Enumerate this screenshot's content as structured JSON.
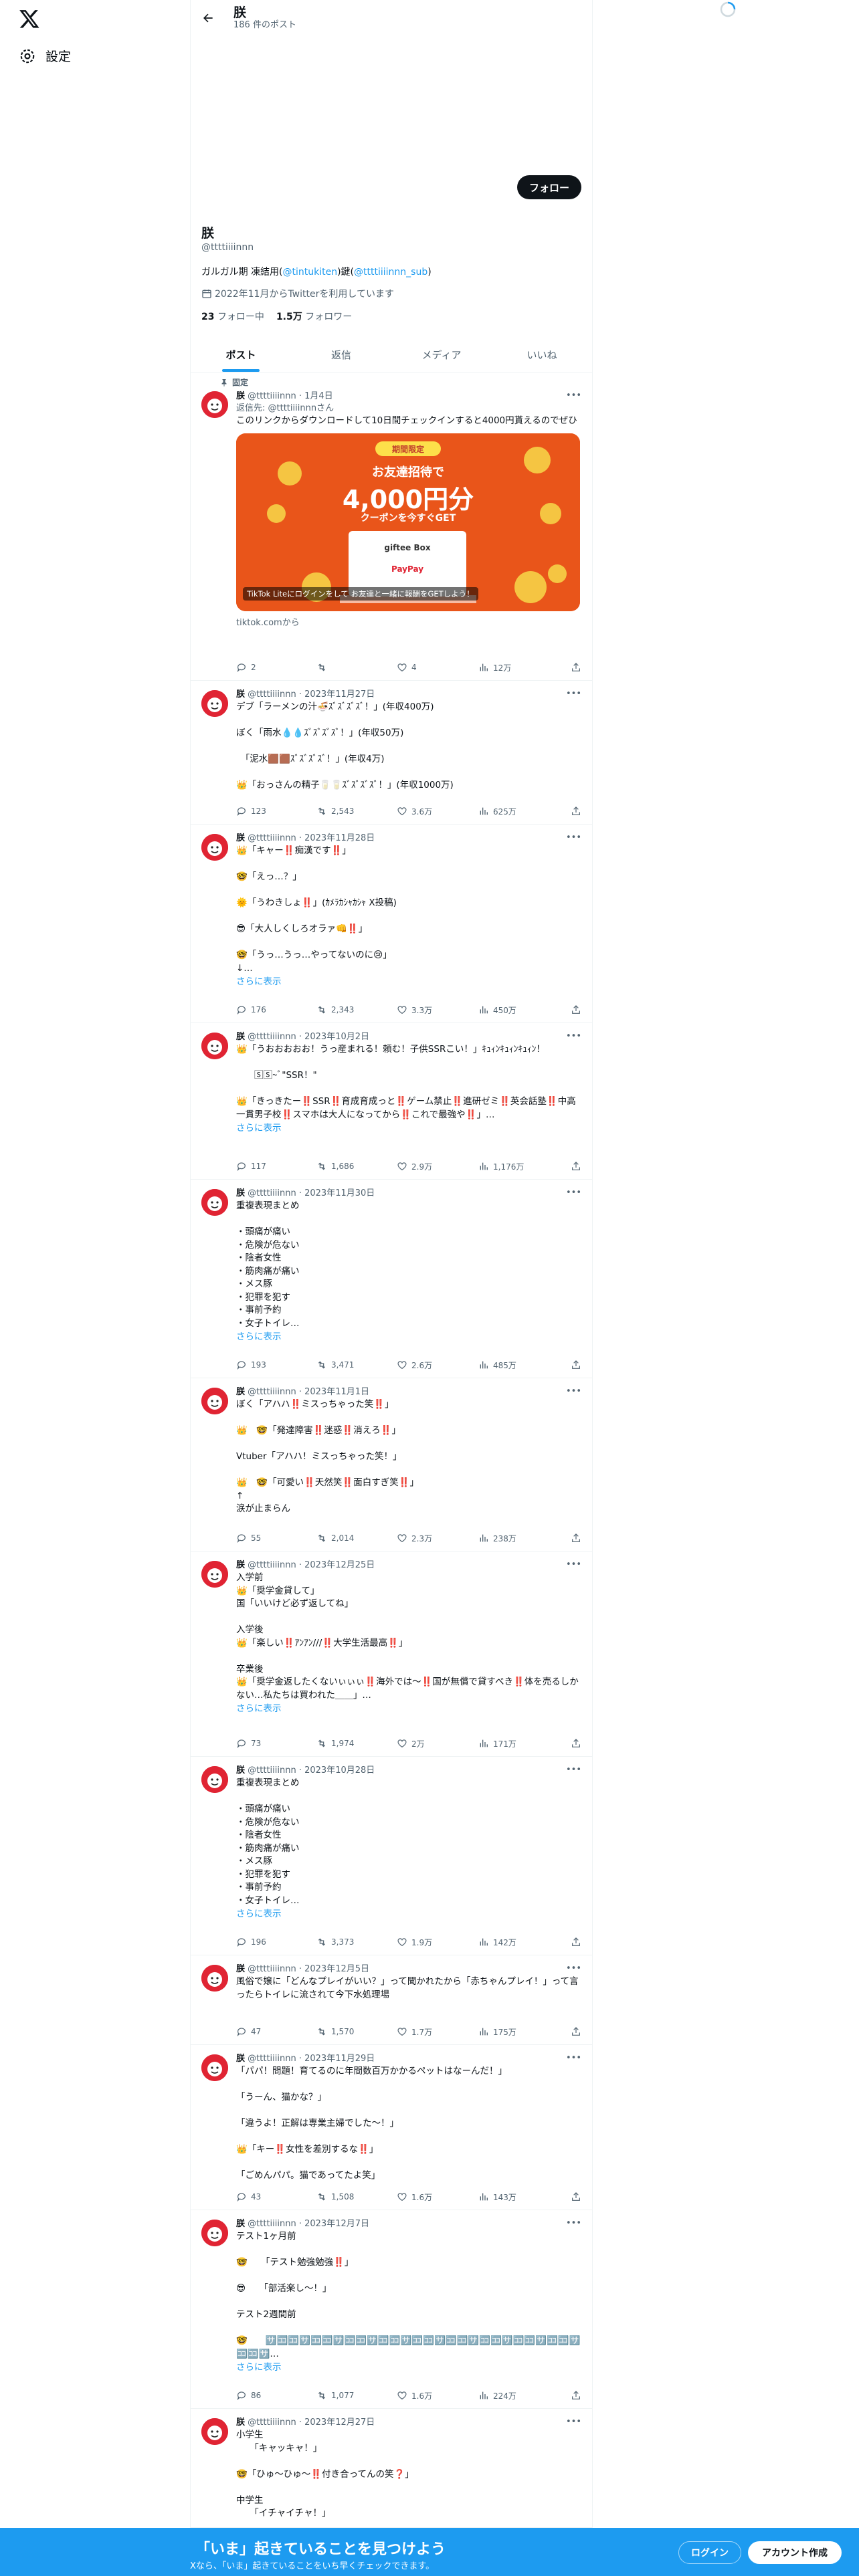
{
  "nav": {
    "settings_label": "設定"
  },
  "header": {
    "name": "朕",
    "post_count": "186 件のポスト"
  },
  "profile": {
    "follow_label": "フォロー",
    "name": "朕",
    "handle": "@ttttiiiinnn",
    "bio_prefix": "ガルガル期 凍結用(",
    "bio_link1": "@tintukiten",
    "bio_mid": ")鍵(",
    "bio_link2": "@ttttiiiinnn_sub",
    "bio_suffix": ")",
    "joined": "2022年11月からTwitterを利用しています",
    "following_count": "23",
    "following_label": "フォロー中",
    "followers_count": "1.5万",
    "followers_label": "フォロワー"
  },
  "tabs": [
    "ポスト",
    "返信",
    "メディア",
    "いいね"
  ],
  "pinned_label": "固定",
  "tweets": [
    {
      "name": "朕",
      "meta": "@ttttiiiinnn · 1月4日",
      "reply_to": "返信先: @ttttiiiinnnさん",
      "text": "このリンクからダウンロードして10日間チェックインすると4000円貰えるのでぜひ",
      "show_more": "",
      "card": {
        "badge": "期間限定",
        "line1": "お友達招待で",
        "big": "4,000円分",
        "line3": "クーポンを今すぐGET",
        "gift": "giftee Box",
        "pay": "PayPay",
        "caption": "TikTok Liteにログインをして お友達と一緒に報酬をGETしよう！",
        "source": "tiktok.comから"
      },
      "reply": "2",
      "rt": "",
      "like": "4",
      "views": "12万"
    },
    {
      "name": "朕",
      "meta": "@ttttiiiinnn · 2023年11月27日",
      "text": "デブ「ラーメンの汁🍜ｽﾞｽﾞｽﾞｽﾞ！」(年収400万)\n\nぼく「雨水💧💧ｽﾞｽﾞｽﾞｽﾞ！」(年収50万)\n\n　「泥水🟫🟫ｽﾞｽﾞｽﾞｽﾞ！」(年収4万)\n\n👑「おっさんの精子🥛🥛ｽﾞｽﾞｽﾞｽﾞ！」(年収1000万)",
      "show_more": "",
      "reply": "123",
      "rt": "2,543",
      "like": "3.6万",
      "views": "625万"
    },
    {
      "name": "朕",
      "meta": "@ttttiiiinnn · 2023年11月28日",
      "text": "👑「キャー‼️痴漢です‼️」\n\n🤓「えっ…？」\n\n🌞「うわきしょ‼️」(ｶﾒﾗｶｼｬｶｼｬ X投稿)\n\n😎「大人しくしろオラァ👊‼️」\n\n🤓「うっ…うっ…やってないのに😢」\n↓…",
      "show_more": "さらに表示",
      "reply": "176",
      "rt": "2,343",
      "like": "3.3万",
      "views": "450万"
    },
    {
      "name": "朕",
      "meta": "@ttttiiiinnn · 2023年10月2日",
      "text": "👑「うおおおおお！うっ産まれる！頼む！子供SSRこい！」ｷｭｨﾝｷｭｨﾝｷｭｨﾝ！\n\n　　🅂🅂~ﾞ\"SSR！\"\n\n👑「きっきたー‼️SSR‼️育成育成っと‼️ゲーム禁止‼️進研ゼミ‼️英会話塾‼️中高一貫男子校‼️スマホは大人になってから‼️これで最強や‼️」…",
      "show_more": "さらに表示",
      "reply": "117",
      "rt": "1,686",
      "like": "2.9万",
      "views": "1,176万"
    },
    {
      "name": "朕",
      "meta": "@ttttiiiinnn · 2023年11月30日",
      "text": "重複表現まとめ\n\n・頭痛が痛い\n・危険が危ない\n・陰者女性\n・筋肉痛が痛い\n・メス豚\n・犯罪を犯す\n・事前予約\n・女子トイレ…",
      "show_more": "さらに表示",
      "reply": "193",
      "rt": "3,471",
      "like": "2.6万",
      "views": "485万"
    },
    {
      "name": "朕",
      "meta": "@ttttiiiinnn · 2023年11月1日",
      "text": "ぼく「アハハ‼️ミスっちゃった笑‼️」\n\n👑　🤓「発達障害‼️迷惑‼️消えろ‼️」\n\nVtuber「アハハ！ミスっちゃった笑！」\n\n👑　🤓「可愛い‼️天然笑‼️面白すぎ笑‼️」\n↑\n涙が止まらん",
      "show_more": "",
      "reply": "55",
      "rt": "2,014",
      "like": "2.3万",
      "views": "238万"
    },
    {
      "name": "朕",
      "meta": "@ttttiiiinnn · 2023年12月25日",
      "text": "入学前\n👑「奨学金貸して」\n国「いいけど必ず返してね」\n\n入学後\n👑「楽しい‼️ｱﾝｱﾝ///‼️大学生活最高‼️」\n\n卒業後\n👑「奨学金返したくないぃぃぃ‼️海外では〜‼️国が無償で貸すべき‼️体を売るしかない…私たちは買われた＿＿」…",
      "show_more": "さらに表示",
      "reply": "73",
      "rt": "1,974",
      "like": "2万",
      "views": "171万"
    },
    {
      "name": "朕",
      "meta": "@ttttiiiinnn · 2023年10月28日",
      "text": "重複表現まとめ\n\n・頭痛が痛い\n・危険が危ない\n・陰者女性\n・筋肉痛が痛い\n・メス豚\n・犯罪を犯す\n・事前予約\n・女子トイレ…",
      "show_more": "さらに表示",
      "reply": "196",
      "rt": "3,373",
      "like": "1.9万",
      "views": "142万"
    },
    {
      "name": "朕",
      "meta": "@ttttiiiinnn · 2023年12月5日",
      "text": "風俗で嬢に「どんなプレイがいい？」って聞かれたから「赤ちゃんプレイ！」って言ったらトイレに流されて今下水処理場",
      "show_more": "",
      "reply": "47",
      "rt": "1,570",
      "like": "1.7万",
      "views": "175万"
    },
    {
      "name": "朕",
      "meta": "@ttttiiiinnn · 2023年11月29日",
      "text": "「パパ！問題！育てるのに年間数百万かかるペットはなーんだ！」\n\n「うーん、猫かな？」\n\n「違うよ！正解は専業主婦でした〜！」\n\n👑「キー‼️女性を差別するな‼️」\n\n「ごめんパパ。猫であってたよ笑」",
      "show_more": "",
      "reply": "43",
      "rt": "1,508",
      "like": "1.6万",
      "views": "143万"
    },
    {
      "name": "朕",
      "meta": "@ttttiiiinnn · 2023年12月7日",
      "text": "テスト1ヶ月前\n\n🤓　　「テスト勉強勉強‼️」\n\n😎　　「部活楽し〜！」\n\nテスト2週間前\n\n🤓　　🈂️🈁🈁🈂️🈁🈁🈂️🈁🈁🈂️🈁🈁🈂️🈁🈁🈂️🈁🈁🈂️🈁🈁🈂️🈁🈁🈂️🈁🈁🈂️🈁🈁🈂️…",
      "show_more": "さらに表示",
      "reply": "86",
      "rt": "1,077",
      "like": "1.6万",
      "views": "224万"
    },
    {
      "name": "朕",
      "meta": "@ttttiiiinnn · 2023年12月27日",
      "text": "小学生\n　　「キャッキャ！」\n\n🤓「ひゅ〜ひゅ〜‼️付き合ってんの笑❓」\n\n中学生\n　　「イチャイチャ！」",
      "show_more": "",
      "reply": "",
      "rt": "",
      "like": "",
      "views": ""
    }
  ],
  "bottom_bar": {
    "title": "「いま」起きていることを見つけよう",
    "subtitle": "Xなら、「いま」起きていることをいち早くチェックできます。",
    "login": "ログイン",
    "signup": "アカウント作成"
  }
}
